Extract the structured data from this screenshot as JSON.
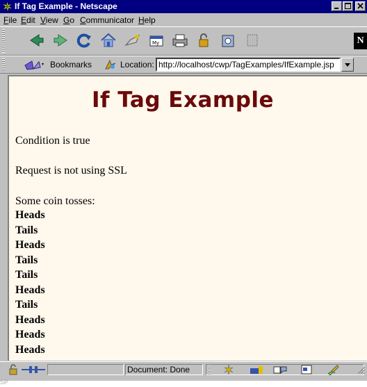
{
  "window": {
    "title": "If Tag Example - Netscape"
  },
  "menu": [
    {
      "pre": "",
      "u": "F",
      "post": "ile"
    },
    {
      "pre": "",
      "u": "E",
      "post": "dit"
    },
    {
      "pre": "",
      "u": "V",
      "post": "iew"
    },
    {
      "pre": "",
      "u": "G",
      "post": "o"
    },
    {
      "pre": "",
      "u": "C",
      "post": "ommunicator"
    },
    {
      "pre": "",
      "u": "H",
      "post": "elp"
    }
  ],
  "navbar": {
    "icons": [
      "back-icon",
      "forward-icon",
      "reload-icon",
      "home-icon",
      "search-icon",
      "my-netscape-icon",
      "print-icon",
      "security-icon",
      "shop-icon",
      "stop-icon"
    ],
    "logo": "N"
  },
  "locationbar": {
    "bookmarks_label": "Bookmarks",
    "location_label": "Location:",
    "url": "http://localhost/cwp/TagExamples/IfExample.jsp"
  },
  "page": {
    "heading": "If Tag Example",
    "paragraphs": [
      "Condition is true",
      "Request is not using SSL",
      "Some coin tosses:"
    ],
    "tosses": [
      "Heads",
      "Tails",
      "Heads",
      "Tails",
      "Tails",
      "Heads",
      "Tails",
      "Heads",
      "Heads",
      "Heads"
    ]
  },
  "status": {
    "text": "Document: Done"
  },
  "below": "SP",
  "colors": {
    "titlebar": "#000080",
    "heading": "#6a0a0a",
    "page_background": "#fff8ec",
    "chrome": "#c0c0c0"
  }
}
